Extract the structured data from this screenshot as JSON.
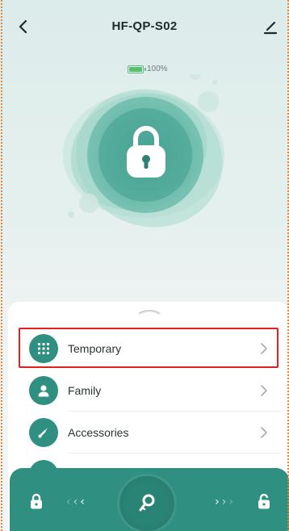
{
  "header": {
    "title": "HF-QP-S02",
    "back_icon": "chevron-left-icon",
    "edit_icon": "pencil-icon"
  },
  "battery": {
    "level_text": "100%",
    "level_fraction": 1.0,
    "color": "#58c06a"
  },
  "lock_visual": {
    "icon": "padlock-icon",
    "accent": "#2f8f80"
  },
  "menu": {
    "items": [
      {
        "label": "Temporary",
        "icon": "keypad-grid-icon",
        "highlighted": true
      },
      {
        "label": "Family",
        "icon": "person-icon",
        "highlighted": false
      },
      {
        "label": "Accessories",
        "icon": "wrench-icon",
        "highlighted": false
      }
    ]
  },
  "controls": {
    "left_icon": "lock-icon",
    "center_icon": "key-icon",
    "right_icon": "unlock-icon",
    "left_arrows": "‹ ‹ ‹",
    "right_arrows": "› › ›"
  },
  "colors": {
    "brand": "#2f8f80",
    "highlight": "#e02020"
  }
}
